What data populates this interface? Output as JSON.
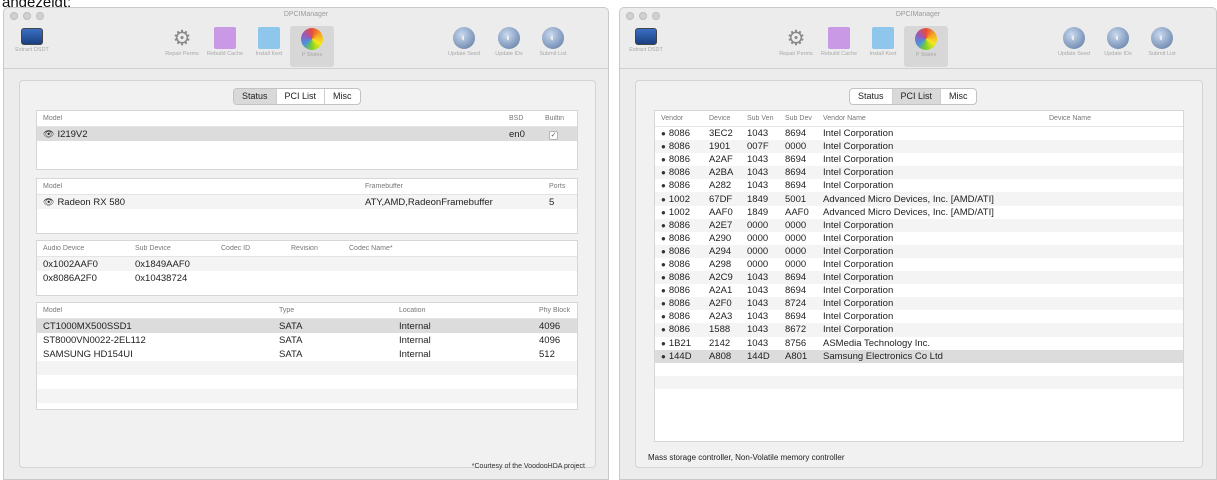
{
  "caption": "angezeigt:",
  "left_window": {
    "title": "DPCIManager",
    "toolbar": [
      {
        "icon": "monitor-icon",
        "label": "Extract DSDT",
        "active": false
      },
      {
        "icon": "gear-icon",
        "label": "Repair Perms",
        "active": false
      },
      {
        "icon": "folder-pink-icon",
        "label": "Rebuild Cache",
        "active": false
      },
      {
        "icon": "folder-blue-icon",
        "label": "Install Kext",
        "active": false
      },
      {
        "icon": "color-wheel-icon",
        "label": "P States",
        "active": true
      },
      {
        "icon": "globe-icon",
        "label": "Update Seed",
        "active": false
      },
      {
        "icon": "globe-icon",
        "label": "Update IDs",
        "active": false
      },
      {
        "icon": "globe-icon",
        "label": "Submit List",
        "active": false
      }
    ],
    "tabs": [
      "Status",
      "PCI List",
      "Misc"
    ],
    "selected_tab": "Status",
    "network": {
      "headers": [
        "Model",
        "BSD",
        "Builtin"
      ],
      "rows": [
        {
          "model": "I219V2",
          "bsd": "en0",
          "builtin": "✓"
        }
      ]
    },
    "graphics": {
      "headers": [
        "Model",
        "Framebuffer",
        "Ports"
      ],
      "rows": [
        {
          "model": "Radeon RX 580",
          "framebuffer": "ATY,AMD,RadeonFramebuffer",
          "ports": "5"
        }
      ]
    },
    "audio": {
      "headers": [
        "Audio Device",
        "Sub Device",
        "Codec ID",
        "Revision",
        "Codec Name*"
      ],
      "rows": [
        {
          "device": "0x1002AAF0",
          "sub": "0x1849AAF0"
        },
        {
          "device": "0x8086A2F0",
          "sub": "0x10438724"
        }
      ]
    },
    "storage": {
      "headers": [
        "Model",
        "Type",
        "Location",
        "Phy Block"
      ],
      "rows": [
        {
          "model": "CT1000MX500SSD1",
          "type": "SATA",
          "location": "Internal",
          "block": "4096"
        },
        {
          "model": "ST8000VN0022-2EL112",
          "type": "SATA",
          "location": "Internal",
          "block": "4096"
        },
        {
          "model": "SAMSUNG HD154UI",
          "type": "SATA",
          "location": "Internal",
          "block": "512"
        }
      ]
    },
    "footnote": "*Courtesy of the VoodooHDA project"
  },
  "right_window": {
    "title": "DPCIManager",
    "toolbar": [
      {
        "icon": "monitor-icon",
        "label": "Extract DSDT",
        "active": false
      },
      {
        "icon": "gear-icon",
        "label": "Repair Perms",
        "active": false
      },
      {
        "icon": "folder-pink-icon",
        "label": "Rebuild Cache",
        "active": false
      },
      {
        "icon": "folder-blue-icon",
        "label": "Install Kext",
        "active": false
      },
      {
        "icon": "color-wheel-icon",
        "label": "P States",
        "active": true
      },
      {
        "icon": "globe-icon",
        "label": "Update Seed",
        "active": false
      },
      {
        "icon": "globe-icon",
        "label": "Update IDs",
        "active": false
      },
      {
        "icon": "globe-icon",
        "label": "Submit List",
        "active": false
      }
    ],
    "tabs": [
      "Status",
      "PCI List",
      "Misc"
    ],
    "selected_tab": "PCI List",
    "pci": {
      "headers": [
        "Vendor",
        "Device",
        "Sub Ven",
        "Sub Dev",
        "Vendor Name",
        "Device Name"
      ],
      "rows": [
        [
          "8086",
          "3EC2",
          "1043",
          "8694",
          "Intel Corporation",
          ""
        ],
        [
          "8086",
          "1901",
          "007F",
          "0000",
          "Intel Corporation",
          ""
        ],
        [
          "8086",
          "A2AF",
          "1043",
          "8694",
          "Intel Corporation",
          ""
        ],
        [
          "8086",
          "A2BA",
          "1043",
          "8694",
          "Intel Corporation",
          ""
        ],
        [
          "8086",
          "A282",
          "1043",
          "8694",
          "Intel Corporation",
          ""
        ],
        [
          "1002",
          "67DF",
          "1849",
          "5001",
          "Advanced Micro Devices, Inc. [AMD/ATI]",
          ""
        ],
        [
          "1002",
          "AAF0",
          "1849",
          "AAF0",
          "Advanced Micro Devices, Inc. [AMD/ATI]",
          ""
        ],
        [
          "8086",
          "A2E7",
          "0000",
          "0000",
          "Intel Corporation",
          ""
        ],
        [
          "8086",
          "A290",
          "0000",
          "0000",
          "Intel Corporation",
          ""
        ],
        [
          "8086",
          "A294",
          "0000",
          "0000",
          "Intel Corporation",
          ""
        ],
        [
          "8086",
          "A298",
          "0000",
          "0000",
          "Intel Corporation",
          ""
        ],
        [
          "8086",
          "A2C9",
          "1043",
          "8694",
          "Intel Corporation",
          ""
        ],
        [
          "8086",
          "A2A1",
          "1043",
          "8694",
          "Intel Corporation",
          ""
        ],
        [
          "8086",
          "A2F0",
          "1043",
          "8724",
          "Intel Corporation",
          ""
        ],
        [
          "8086",
          "A2A3",
          "1043",
          "8694",
          "Intel Corporation",
          ""
        ],
        [
          "8086",
          "1588",
          "1043",
          "8672",
          "Intel Corporation",
          ""
        ],
        [
          "1B21",
          "2142",
          "1043",
          "8756",
          "ASMedia Technology Inc.",
          ""
        ],
        [
          "144D",
          "A808",
          "144D",
          "A801",
          "Samsung Electronics Co Ltd",
          ""
        ]
      ],
      "selected_row": 17
    },
    "status_text": "Mass storage controller, Non-Volatile memory controller"
  }
}
